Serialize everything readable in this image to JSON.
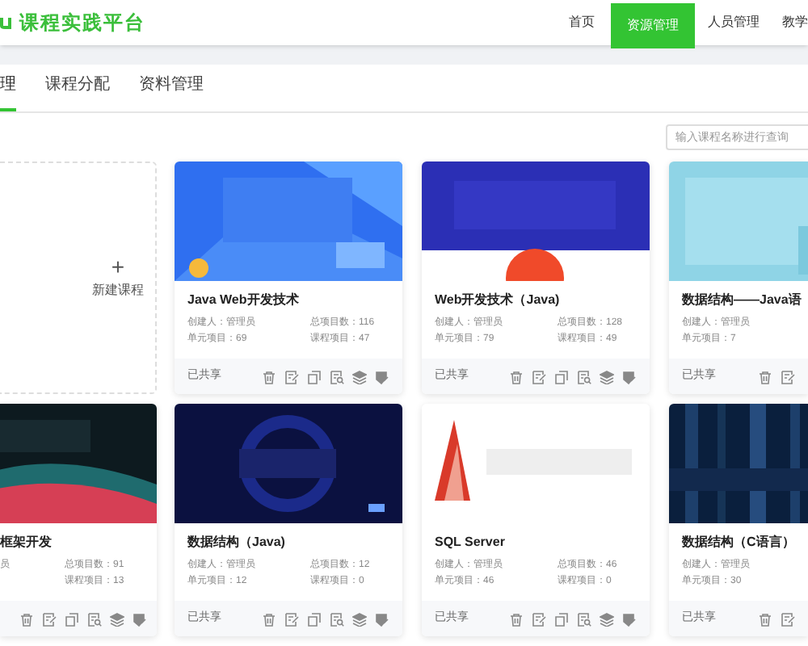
{
  "header": {
    "logo_text": "课程实践平台",
    "nav": [
      {
        "label": "首页",
        "selected": false
      },
      {
        "label": "资源管理",
        "selected": true
      },
      {
        "label": "人员管理",
        "selected": false
      },
      {
        "label": "教学",
        "selected": false
      }
    ]
  },
  "tabs": [
    {
      "label": "理",
      "selected": true
    },
    {
      "label": "课程分配",
      "selected": false
    },
    {
      "label": "资料管理",
      "selected": false
    }
  ],
  "search": {
    "placeholder": "输入课程名称进行查询"
  },
  "rows": [
    {
      "cards": [
        {
          "kind": "new",
          "icon": "+",
          "label": "新建课程"
        },
        {
          "kind": "course",
          "title": "Java Web开发技术",
          "meta_left": [
            "创建人：管理员",
            "单元项目：69"
          ],
          "meta_right": [
            "总项目数：116",
            "课程项目：47"
          ],
          "status": "已共享",
          "actions": [
            {
              "kind": "delete"
            },
            {
              "kind": "edit"
            },
            {
              "kind": "copy"
            },
            {
              "kind": "preview"
            },
            {
              "kind": "layers"
            },
            {
              "kind": "permission"
            }
          ]
        },
        {
          "kind": "course",
          "title": "Web开发技术（Java)",
          "meta_left": [
            "创建人：管理员",
            "单元项目：79"
          ],
          "meta_right": [
            "总项目数：128",
            "课程项目：49"
          ],
          "status": "已共享",
          "actions": [
            {
              "kind": "delete"
            },
            {
              "kind": "edit"
            },
            {
              "kind": "copy"
            },
            {
              "kind": "preview"
            },
            {
              "kind": "layers"
            },
            {
              "kind": "permission"
            }
          ]
        },
        {
          "kind": "course",
          "title": "数据结构——Java语",
          "meta_left": [
            "创建人：管理员",
            "单元项目：7"
          ],
          "status": "已共享",
          "actions": [
            {
              "kind": "delete"
            },
            {
              "kind": "edit"
            }
          ]
        }
      ]
    },
    {
      "cards": [
        {
          "kind": "course",
          "title": "框架开发",
          "meta_left": [
            "员"
          ],
          "meta_right": [
            "总项目数：91",
            "课程项目：13"
          ],
          "actions": [
            {
              "kind": "delete"
            },
            {
              "kind": "edit"
            },
            {
              "kind": "copy"
            },
            {
              "kind": "preview"
            },
            {
              "kind": "layers"
            },
            {
              "kind": "permission"
            }
          ]
        },
        {
          "kind": "course",
          "title": "数据结构（Java)",
          "meta_left": [
            "创建人：管理员",
            "单元项目：12"
          ],
          "meta_right": [
            "总项目数：12",
            "课程项目：0"
          ],
          "status": "已共享",
          "actions": [
            {
              "kind": "delete"
            },
            {
              "kind": "edit"
            },
            {
              "kind": "copy"
            },
            {
              "kind": "preview"
            },
            {
              "kind": "layers"
            },
            {
              "kind": "permission"
            }
          ]
        },
        {
          "kind": "course",
          "title": "SQL Server",
          "meta_left": [
            "创建人：管理员",
            "单元项目：46"
          ],
          "meta_right": [
            "总项目数：46",
            "课程项目：0"
          ],
          "status": "已共享",
          "actions": [
            {
              "kind": "delete"
            },
            {
              "kind": "edit"
            },
            {
              "kind": "copy"
            },
            {
              "kind": "preview"
            },
            {
              "kind": "layers"
            },
            {
              "kind": "permission"
            }
          ]
        },
        {
          "kind": "course",
          "title": "数据结构（C语言）",
          "meta_left": [
            "创建人：管理员",
            "单元项目：30"
          ],
          "status": "已共享",
          "actions": [
            {
              "kind": "delete"
            },
            {
              "kind": "edit"
            }
          ]
        }
      ]
    }
  ]
}
